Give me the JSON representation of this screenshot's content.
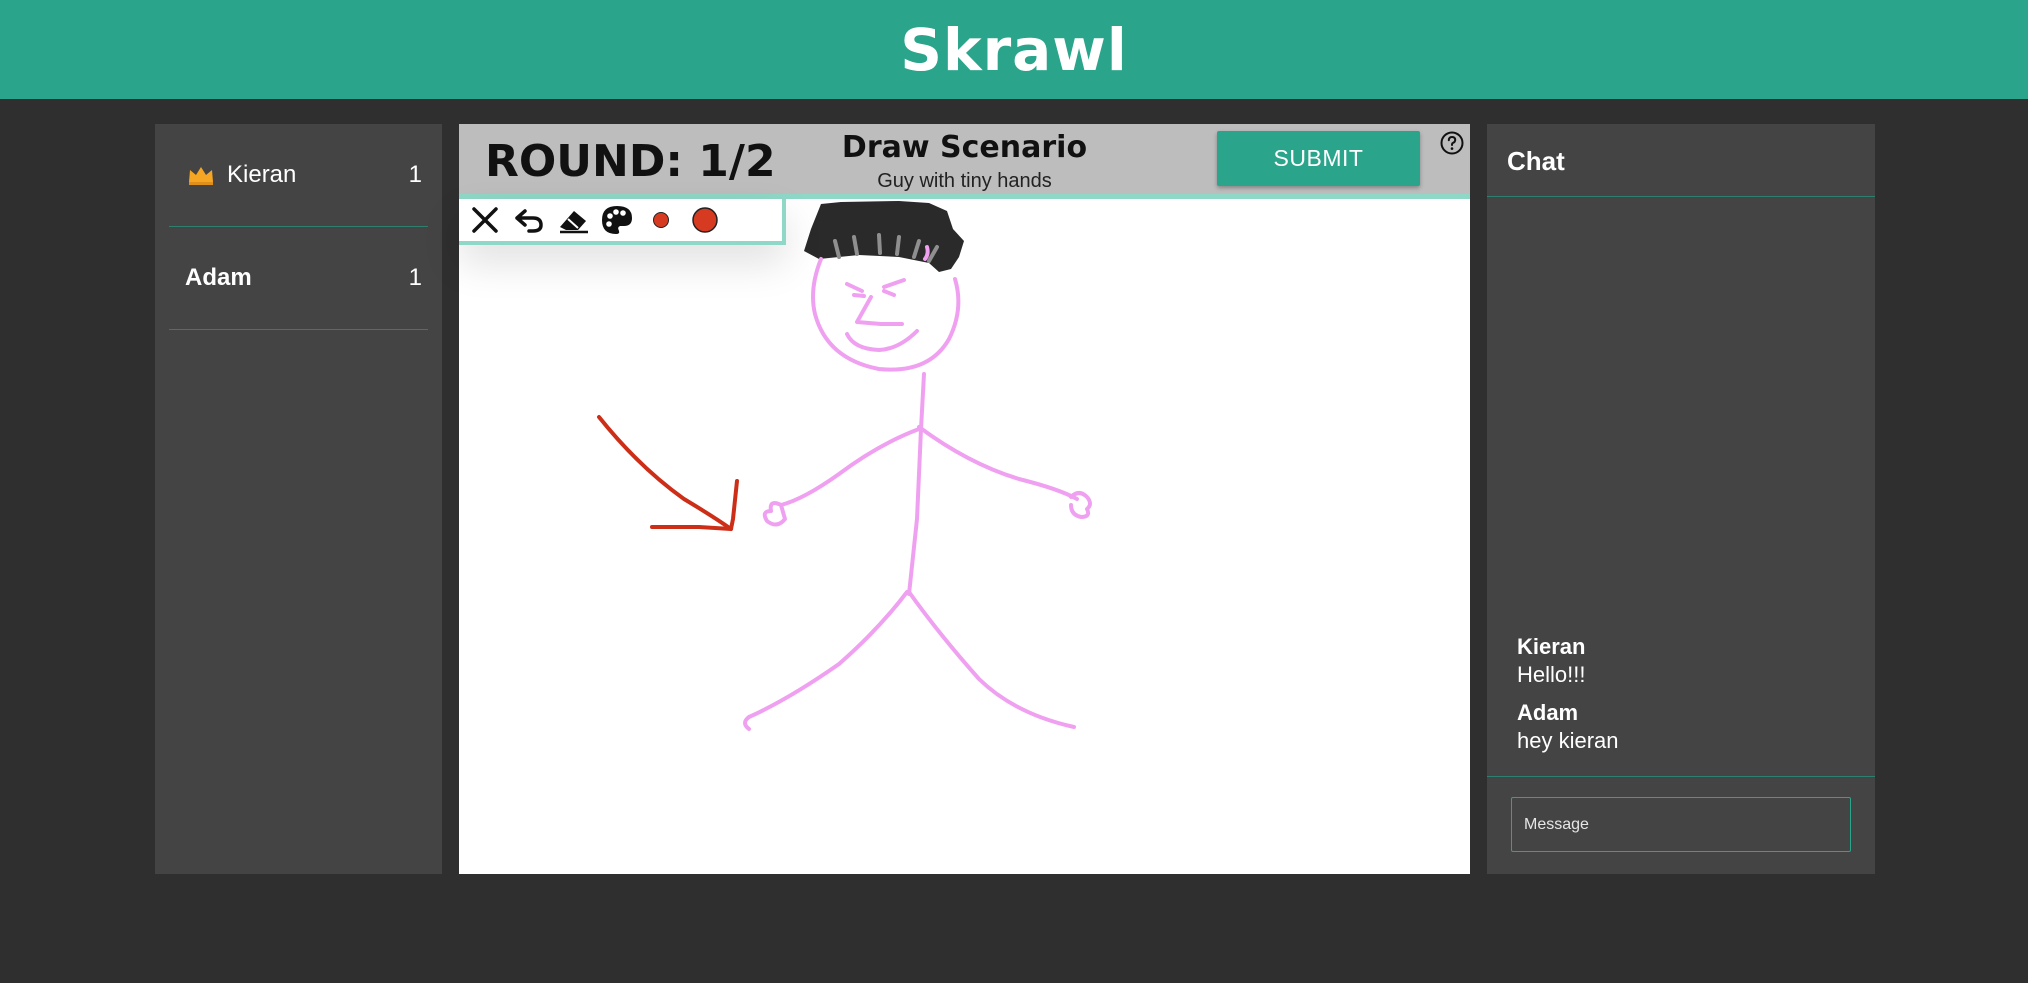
{
  "app": {
    "title": "Skrawl"
  },
  "players": [
    {
      "name": "Kieran",
      "score": "1",
      "is_host": true
    },
    {
      "name": "Adam",
      "score": "1",
      "is_host": false
    }
  ],
  "game": {
    "round_label": "ROUND: 1/2",
    "scenario_title": "Draw Scenario",
    "scenario_prompt": "Guy with tiny hands",
    "submit_label": "SUBMIT",
    "help_label": "?"
  },
  "toolbar": {
    "tools": [
      "clear-icon",
      "undo-icon",
      "eraser-icon",
      "palette-icon",
      "small-brush-icon",
      "large-brush-icon"
    ],
    "brush_color": "#d63a20"
  },
  "drawing": {
    "figure_color": "#f0a0f0",
    "hat_color": "#2a2a2a",
    "arrow_color": "#cc2e18"
  },
  "chat": {
    "title": "Chat",
    "messages": [
      {
        "author": "Kieran",
        "text": "Hello!!!"
      },
      {
        "author": "Adam",
        "text": "hey kieran"
      }
    ],
    "input_placeholder": "Message"
  },
  "colors": {
    "brand": "#2aa58b",
    "panel": "#444444",
    "background": "#2f2f2f",
    "crown": "#f5a623"
  }
}
